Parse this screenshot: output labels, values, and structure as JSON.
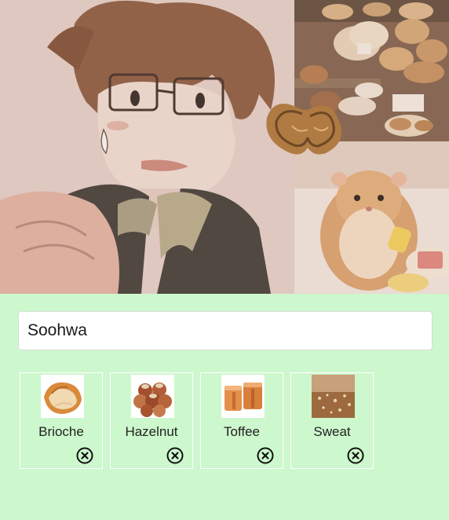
{
  "profile": {
    "name_value": "Soohwa",
    "name_placeholder": ""
  },
  "collage": {
    "panels": [
      "anime-boy-portrait",
      "bakery-shelves",
      "palmier-pastry",
      "hamster-eating"
    ]
  },
  "tags": [
    {
      "label": "Brioche",
      "image": "brioche-photo"
    },
    {
      "label": "Hazelnut",
      "image": "hazelnut-photo"
    },
    {
      "label": "Toffee",
      "image": "toffee-photo"
    },
    {
      "label": "Sweat",
      "image": "sweat-photo"
    }
  ],
  "colors": {
    "background": "#cdf7cd",
    "card_border": "#ffffff",
    "input_border": "#d9dcd9",
    "text": "#222222"
  }
}
